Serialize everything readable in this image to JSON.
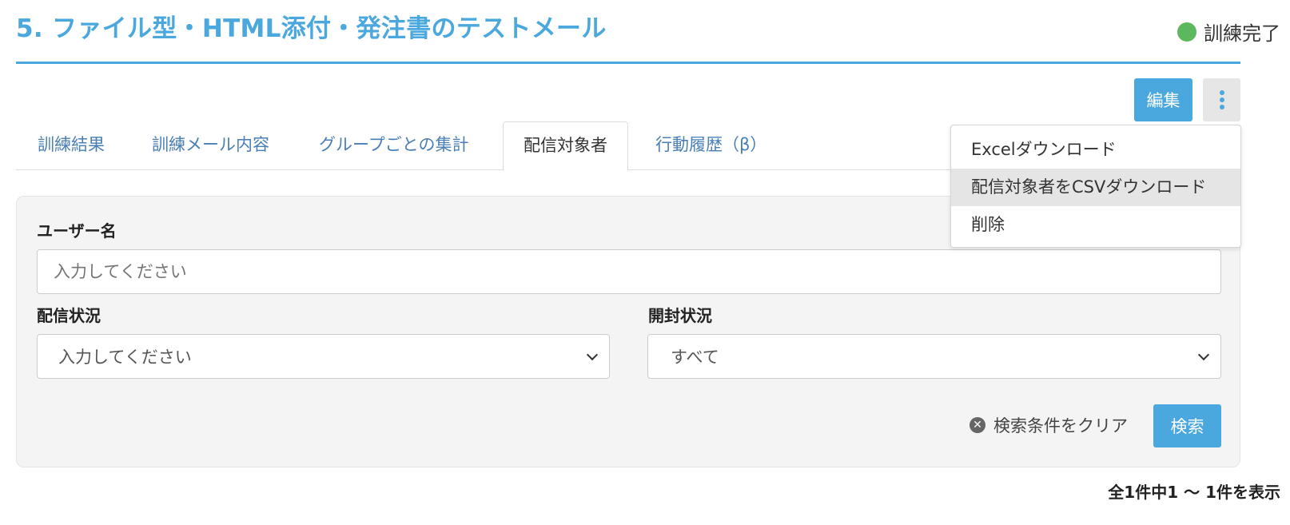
{
  "header": {
    "title": "5. ファイル型・HTML添付・発注書のテストメール",
    "status_label": "訓練完了",
    "status_color": "#5cb85c",
    "accent_color": "#4aa8de"
  },
  "toolbar": {
    "edit_label": "編集",
    "more_icon": "vertical-ellipsis-icon"
  },
  "tabs": [
    {
      "label": "訓練結果",
      "active": false
    },
    {
      "label": "訓練メール内容",
      "active": false
    },
    {
      "label": "グループごとの集計",
      "active": false
    },
    {
      "label": "配信対象者",
      "active": true
    },
    {
      "label": "行動履歴（β）",
      "active": false
    }
  ],
  "dropdown_menu": {
    "items": [
      {
        "label": "Excelダウンロード",
        "highlighted": false
      },
      {
        "label": "配信対象者をCSVダウンロード",
        "highlighted": true
      },
      {
        "label": "削除",
        "highlighted": false
      }
    ]
  },
  "filters": {
    "username": {
      "label": "ユーザー名",
      "placeholder": "入力してください"
    },
    "delivery_status": {
      "label": "配信状況",
      "selected": "入力してください"
    },
    "open_status": {
      "label": "開封状況",
      "selected": "すべて"
    },
    "clear_label": "検索条件をクリア",
    "clear_icon": "circle-x-icon",
    "search_label": "検索"
  },
  "results": {
    "summary": "全1件中1 ～ 1件を表示"
  }
}
